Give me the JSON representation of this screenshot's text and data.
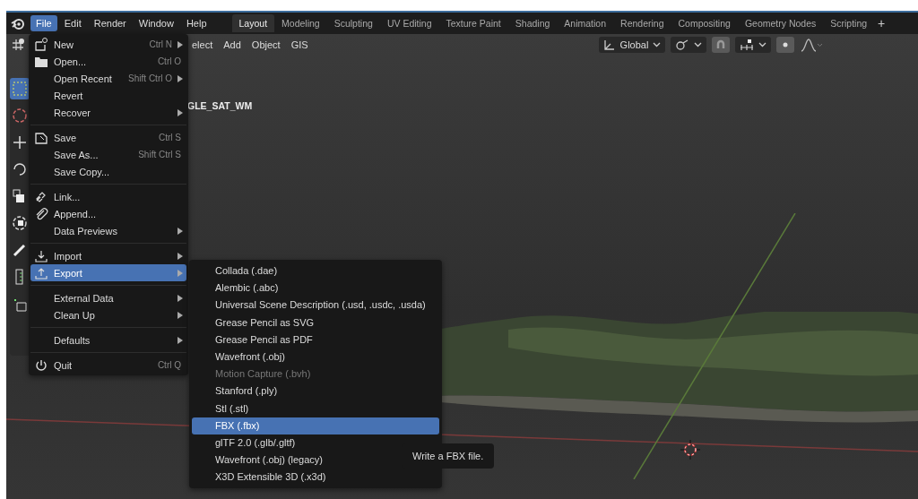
{
  "menubar": [
    {
      "label": "File",
      "selected": true
    },
    {
      "label": "Edit",
      "selected": false
    },
    {
      "label": "Render",
      "selected": false
    },
    {
      "label": "Window",
      "selected": false
    },
    {
      "label": "Help",
      "selected": false
    }
  ],
  "workspaces": [
    {
      "label": "Layout",
      "selected": true
    },
    {
      "label": "Modeling",
      "selected": false
    },
    {
      "label": "Sculpting",
      "selected": false
    },
    {
      "label": "UV Editing",
      "selected": false
    },
    {
      "label": "Texture Paint",
      "selected": false
    },
    {
      "label": "Shading",
      "selected": false
    },
    {
      "label": "Animation",
      "selected": false
    },
    {
      "label": "Rendering",
      "selected": false
    },
    {
      "label": "Compositing",
      "selected": false
    },
    {
      "label": "Geometry Nodes",
      "selected": false
    },
    {
      "label": "Scripting",
      "selected": false
    }
  ],
  "add_workspace": "+",
  "header": {
    "menus": [
      "elect",
      "Add",
      "Object",
      "GIS"
    ],
    "orientation": "Global"
  },
  "viewport": {
    "object_name": "GLE_SAT_WM"
  },
  "file_menu": [
    [
      {
        "label": "New",
        "shortcut": "Ctrl N",
        "submenu": true,
        "selected": false
      },
      {
        "label": "Open...",
        "shortcut": "Ctrl O",
        "submenu": false,
        "selected": false
      },
      {
        "label": "Open Recent",
        "shortcut": "Shift Ctrl O",
        "submenu": true,
        "selected": false
      },
      {
        "label": "Revert",
        "submenu": false,
        "selected": false
      },
      {
        "label": "Recover",
        "submenu": true,
        "selected": false
      }
    ],
    [
      {
        "label": "Save",
        "shortcut": "Ctrl S",
        "submenu": false,
        "selected": false
      },
      {
        "label": "Save As...",
        "shortcut": "Shift Ctrl S",
        "submenu": false,
        "selected": false
      },
      {
        "label": "Save Copy...",
        "submenu": false,
        "selected": false
      }
    ],
    [
      {
        "label": "Link...",
        "submenu": false,
        "selected": false
      },
      {
        "label": "Append...",
        "submenu": false,
        "selected": false
      },
      {
        "label": "Data Previews",
        "submenu": true,
        "selected": false
      }
    ],
    [
      {
        "label": "Import",
        "submenu": true,
        "selected": false
      },
      {
        "label": "Export",
        "submenu": true,
        "selected": true
      }
    ],
    [
      {
        "label": "External Data",
        "submenu": true,
        "selected": false
      },
      {
        "label": "Clean Up",
        "submenu": true,
        "selected": false
      }
    ],
    [
      {
        "label": "Defaults",
        "submenu": true,
        "selected": false
      }
    ],
    [
      {
        "label": "Quit",
        "shortcut": "Ctrl Q",
        "submenu": false,
        "selected": false
      }
    ]
  ],
  "export_menu": [
    {
      "label": "Collada (.dae)",
      "disabled": false,
      "selected": false
    },
    {
      "label": "Alembic (.abc)",
      "disabled": false,
      "selected": false
    },
    {
      "label": "Universal Scene Description (.usd, .usdc, .usda)",
      "disabled": false,
      "selected": false
    },
    {
      "label": "Grease Pencil as SVG",
      "disabled": false,
      "selected": false
    },
    {
      "label": "Grease Pencil as PDF",
      "disabled": false,
      "selected": false
    },
    {
      "label": "Wavefront (.obj)",
      "disabled": false,
      "selected": false
    },
    {
      "label": "Motion Capture (.bvh)",
      "disabled": true,
      "selected": false
    },
    {
      "label": "Stanford (.ply)",
      "disabled": false,
      "selected": false
    },
    {
      "label": "Stl (.stl)",
      "disabled": false,
      "selected": false
    },
    {
      "label": "FBX (.fbx)",
      "disabled": false,
      "selected": true
    },
    {
      "label": "glTF 2.0 (.glb/.gltf)",
      "disabled": false,
      "selected": false
    },
    {
      "label": "Wavefront (.obj) (legacy)",
      "disabled": false,
      "selected": false
    },
    {
      "label": "X3D Extensible 3D (.x3d)",
      "disabled": false,
      "selected": false
    }
  ],
  "tooltip": "Write a FBX file."
}
